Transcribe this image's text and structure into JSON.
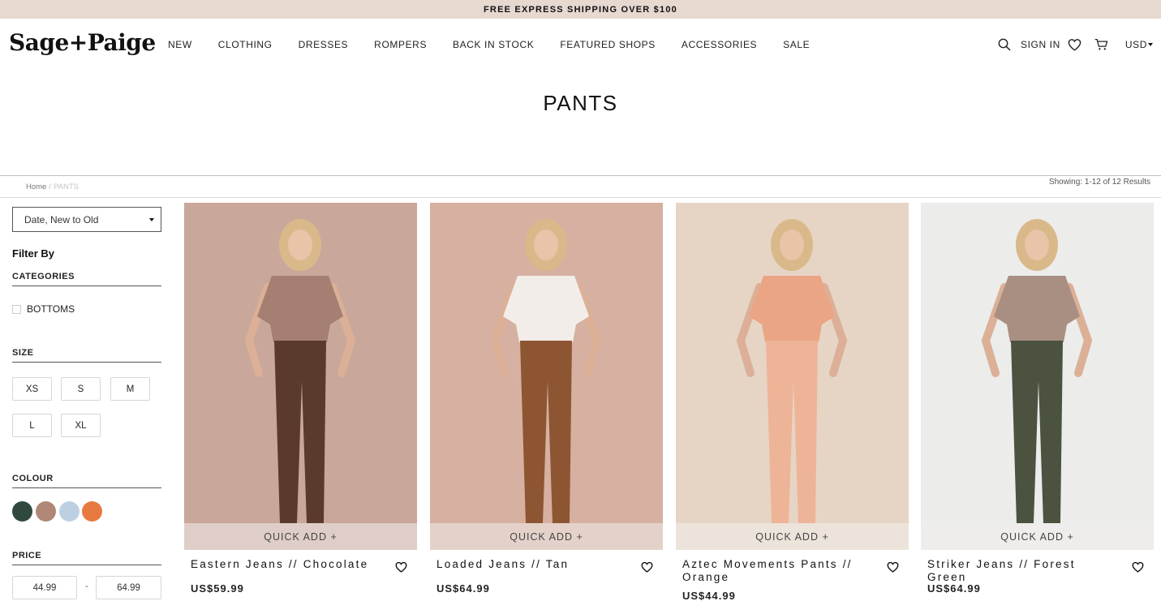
{
  "announcement": "FREE EXPRESS SHIPPING OVER $100",
  "brand": "Sage+Paige",
  "nav": [
    "NEW",
    "CLOTHING",
    "DRESSES",
    "ROMPERS",
    "BACK IN STOCK",
    "FEATURED SHOPS",
    "ACCESSORIES",
    "SALE"
  ],
  "header_utils": {
    "sign_in": "SIGN IN",
    "currency": "USD"
  },
  "page_title": "PANTS",
  "breadcrumb": {
    "home": "Home",
    "separator": "/",
    "current": "PANTS"
  },
  "results_text": "Showing: 1-12 of 12 Results",
  "sort": {
    "selected": "Date, New to Old"
  },
  "filters": {
    "title": "Filter By",
    "categories_label": "CATEGORIES",
    "categories": [
      "BOTTOMS"
    ],
    "size_label": "SIZE",
    "sizes": [
      "XS",
      "S",
      "M",
      "L",
      "XL"
    ],
    "colour_label": "COLOUR",
    "colours": [
      "#2f4a3d",
      "#b08676",
      "#bdd0e2",
      "#e77a40"
    ],
    "price_label": "PRICE",
    "price_min": "44.99",
    "price_dash": "-",
    "price_max": "64.99"
  },
  "quick_add_label": "QUICK ADD +",
  "products": [
    {
      "name": "Eastern Jeans // Chocolate",
      "price": "US$59.99",
      "bg": "#c9a79a",
      "top": "#a47f72",
      "pants": "#5a3a2d"
    },
    {
      "name": "Loaded Jeans // Tan",
      "price": "US$64.99",
      "bg": "#d6b0a0",
      "top": "#f2ede9",
      "pants": "#8e5532"
    },
    {
      "name": "Aztec Movements Pants // Orange",
      "price": "US$44.99",
      "bg": "#e6d5c5",
      "top": "#eaa585",
      "pants": "#eeb497"
    },
    {
      "name": "Striker Jeans // Forest Green",
      "price": "US$64.99",
      "bg": "#ececeb",
      "top": "#a88f82",
      "pants": "#4b5340"
    }
  ]
}
